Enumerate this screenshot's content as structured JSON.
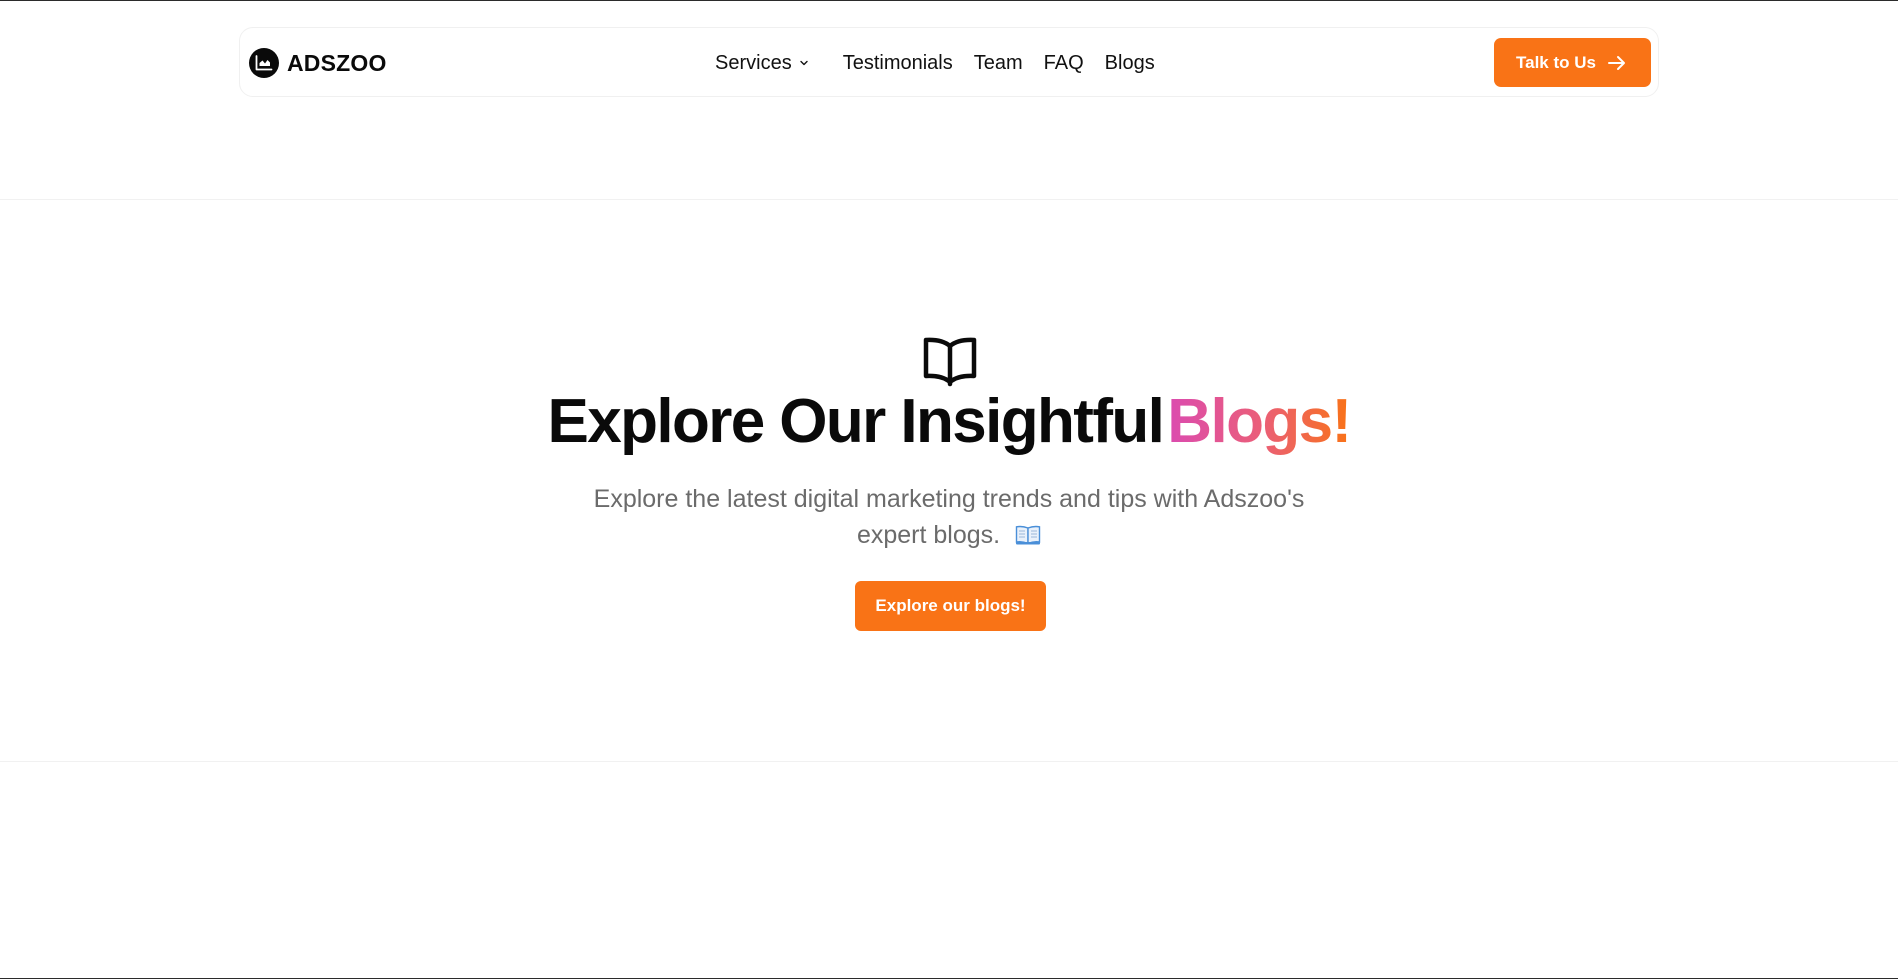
{
  "brand": {
    "name": "ADSZOO",
    "logo_icon": "chart-logo-icon"
  },
  "nav": {
    "items": [
      {
        "label": "Services",
        "icon": "chevron-down-icon"
      },
      {
        "label": "Testimonials"
      },
      {
        "label": "Team"
      },
      {
        "label": "FAQ"
      },
      {
        "label": "Blogs"
      }
    ],
    "cta_label": "Talk to Us",
    "cta_icon": "arrow-right-icon"
  },
  "hero": {
    "icon": "open-book-icon",
    "title_main": "Explore Our Insightful",
    "title_accent": "Blogs!",
    "subtitle": "Explore the latest digital marketing trends and tips with Adszoo's expert blogs.",
    "subtitle_emoji": "open-book-emoji",
    "button_label": "Explore our blogs!"
  },
  "colors": {
    "accent": "#f97316",
    "gradient_start": "#db4bb0",
    "gradient_end": "#f97316",
    "text_dark": "#0a0a0a",
    "text_muted": "#6b6b6b"
  }
}
